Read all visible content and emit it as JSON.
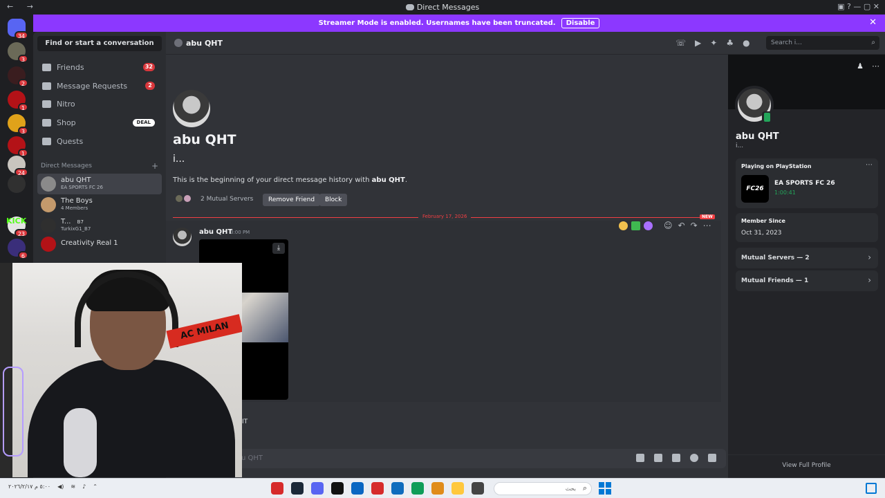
{
  "window": {
    "title": "Direct Messages",
    "nav": "← →",
    "controls": "▣ ? — ▢ ✕"
  },
  "banner": {
    "text": "Streamer Mode is enabled. Usernames have been truncated.",
    "action": "Disable",
    "close": "✕",
    "color": "#8c38ff"
  },
  "rail": {
    "home_badge": "34",
    "servers": [
      {
        "badge": "3",
        "color": "#6b6a58"
      },
      {
        "badge": "2",
        "color": "#3a1d1f"
      },
      {
        "badge": "1",
        "color": "#b31217"
      },
      {
        "badge": "3",
        "color": "#e0a21a"
      },
      {
        "badge": "1",
        "color": "#b31217"
      },
      {
        "badge": "24",
        "color": "#c9c5bf"
      },
      {
        "badge": "",
        "color": "#303030"
      },
      {
        "badge": "23",
        "color": "#e4e4e4"
      },
      {
        "badge": "6",
        "color": "#3a2e7a"
      }
    ],
    "kick": "KICK"
  },
  "sidebar": {
    "find": "Find or start a conversation",
    "nav": [
      {
        "label": "Friends",
        "count": "32"
      },
      {
        "label": "Message Requests",
        "count": "2"
      },
      {
        "label": "Nitro",
        "count": ""
      },
      {
        "label": "Shop",
        "deal": "DEAL"
      },
      {
        "label": "Quests",
        "count": ""
      }
    ],
    "dm_header": "Direct Messages",
    "dms": [
      {
        "name": "abu QHT",
        "sub": "EA SPORTS FC 26",
        "color": "#8a8a8a"
      },
      {
        "name": "The Boys",
        "sub": "4 Members",
        "color": "#c49a6c"
      },
      {
        "name": "T...",
        "sub": "TurkixG1_B7",
        "tag": "B7",
        "color": "#2f2f2f"
      },
      {
        "name": "Creativity Real 1",
        "sub": "",
        "color": "#b31217"
      }
    ]
  },
  "header": {
    "name": "abu QHT",
    "search_placeholder": "Search i..."
  },
  "chat": {
    "welcome_name": "abu QHT",
    "welcome_tag": "i...",
    "intro_prefix": "This is the beginning of your direct message history with ",
    "intro_name": "abu QHT",
    "intro_suffix": ".",
    "mutual_servers": "2 Mutual Servers",
    "remove_friend": "Remove Friend",
    "block": "Block",
    "date_divider": "February 17, 2026",
    "new_tag": "NEW",
    "message": {
      "author": "abu QHT",
      "time": "3:00 PM"
    },
    "composer_placeholder": "u QHT",
    "webcam_caption": "IT"
  },
  "profile": {
    "name": "abu QHT",
    "tag": "i...",
    "activity_label": "Playing on PlayStation",
    "game": "EA SPORTS FC 26",
    "game_art": "FC26",
    "elapsed": "1:00:41",
    "member_since_label": "Member Since",
    "member_since": "Oct 31, 2023",
    "mutual_servers": "Mutual Servers — 2",
    "mutual_friends": "Mutual Friends — 1",
    "view_full": "View Full Profile"
  },
  "webcam": {
    "scarf_text": "AC MILAN"
  },
  "taskbar": {
    "tray": "٥:٠٠ م  ٢٠٢٦/٢/١٧",
    "search_text": "بحث",
    "apps": [
      "#d62b2b",
      "#1b2838",
      "#5865f2",
      "#111111",
      "#0a66c2",
      "#d62b2b",
      "#0f6cbd",
      "#0f9d58",
      "#e08c1a",
      "#ffc83d",
      "#444444"
    ]
  }
}
